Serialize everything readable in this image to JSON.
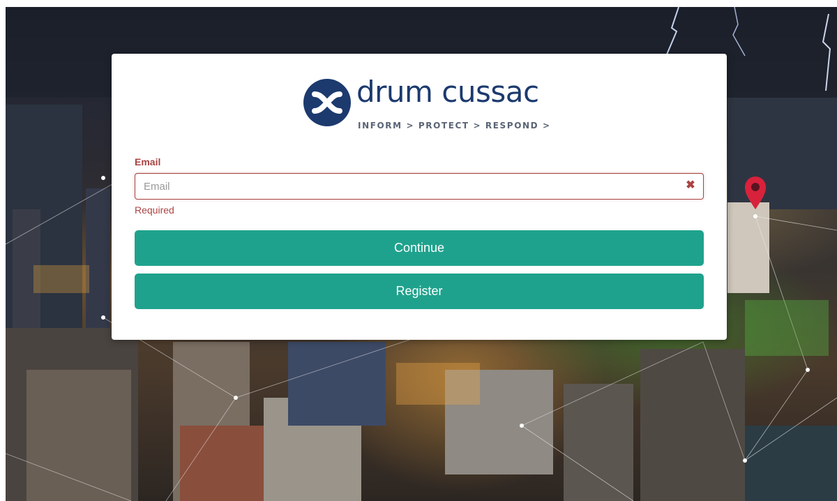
{
  "brand": {
    "name": "drum cussac",
    "tagline": "INFORM > PROTECT > RESPOND >",
    "logo_icon": "x-mark-icon",
    "primary_color": "#1c3a6e"
  },
  "form": {
    "email_label": "Email",
    "email_placeholder": "Email",
    "email_value": "",
    "error_text": "Required",
    "error_color": "#a94442",
    "clear_icon": "close-icon"
  },
  "actions": {
    "continue_label": "Continue",
    "register_label": "Register",
    "button_color": "#1fa28d"
  }
}
